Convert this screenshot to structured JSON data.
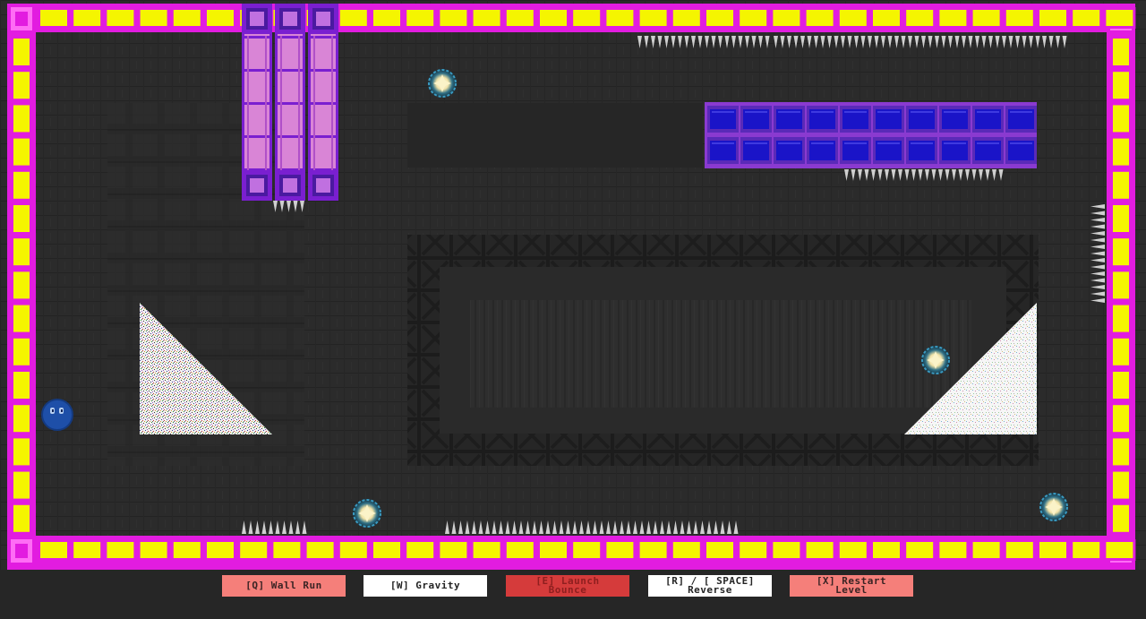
{
  "colors": {
    "background": "#2b2b2b",
    "border_yellow": "#f5f500",
    "border_magenta": "#e21ce0",
    "pillar_fill": "#d985d6",
    "pillar_edge": "#7a1fd0",
    "platform_fill": "#1a14c8",
    "platform_edge": "#8a3ad0",
    "spike": "#cfcfcf",
    "orb_core": "#fbf3c8",
    "orb_glow": "#3a9bc2",
    "player": "#1e4fa8"
  },
  "controls": [
    {
      "label": "[Q] Wall Run",
      "bg": "#f57f7a",
      "fg": "#3a2424"
    },
    {
      "label": "[W] Gravity",
      "bg": "#ffffff",
      "fg": "#242424"
    },
    {
      "label": "[E] Launch\nBounce",
      "bg": "#d53b3b",
      "fg": "#8e1f1f"
    },
    {
      "label": "[R] / [ SPACE]\nReverse",
      "bg": "#ffffff",
      "fg": "#242424"
    },
    {
      "label": "[X] Restart\nLevel",
      "bg": "#f57f7a",
      "fg": "#3a2424"
    }
  ]
}
